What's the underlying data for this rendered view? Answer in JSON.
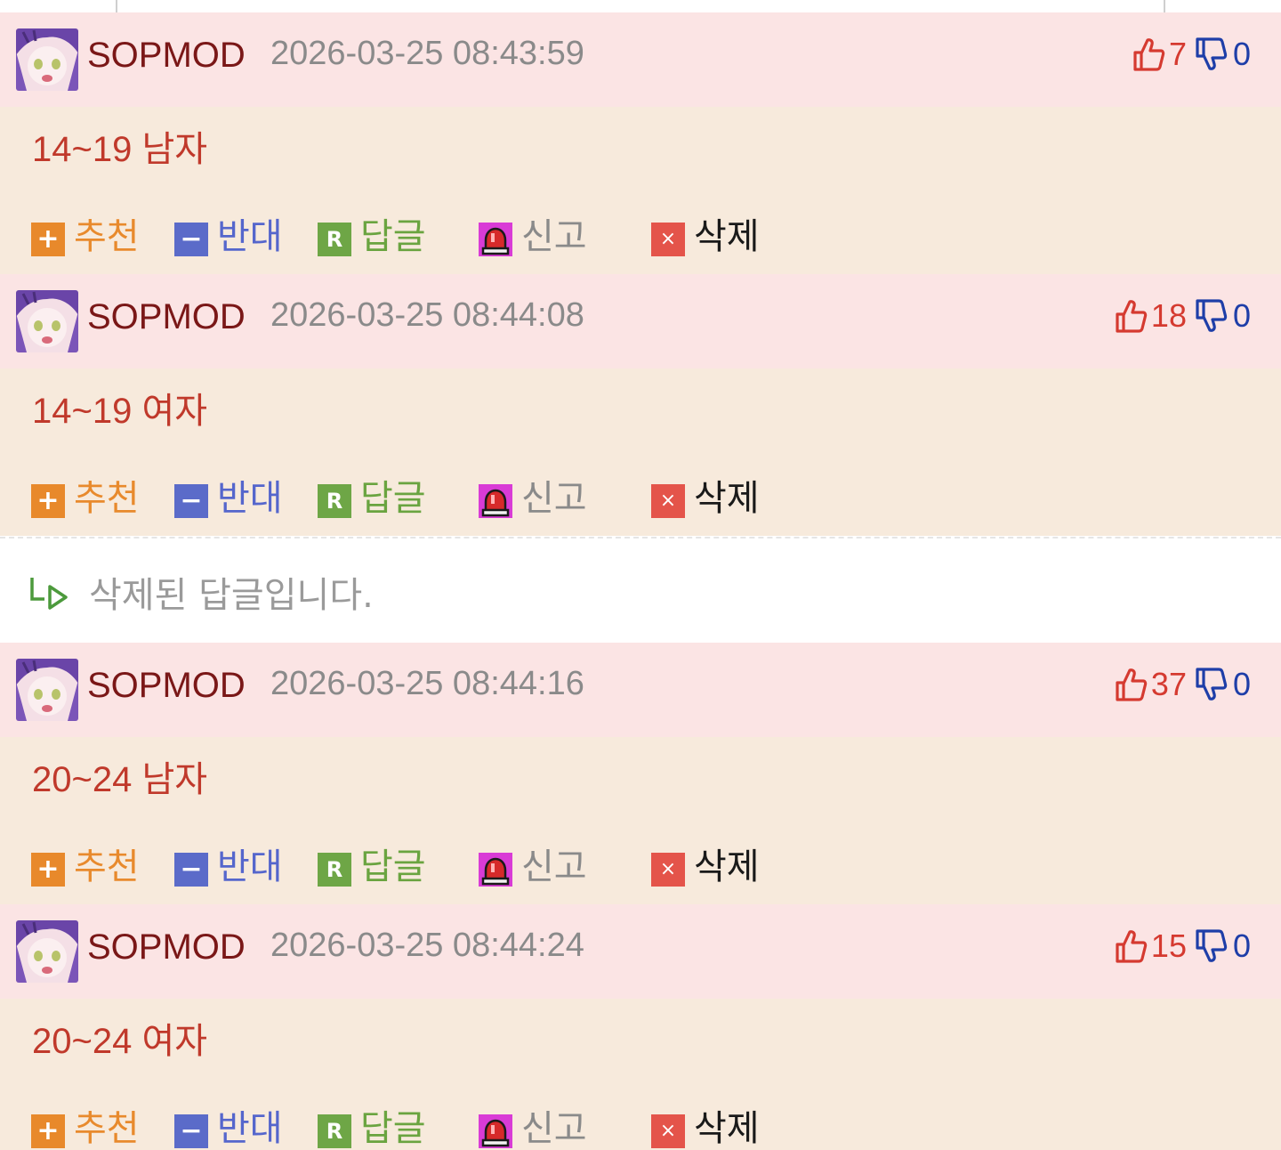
{
  "comments": [
    {
      "nick": "SOPMOD",
      "date": "2026-03-25 08:43:59",
      "text": "14~19 남자",
      "up": "7",
      "down": "0"
    },
    {
      "nick": "SOPMOD",
      "date": "2026-03-25 08:44:08",
      "text": "14~19 여자",
      "up": "18",
      "down": "0"
    },
    {
      "nick": "SOPMOD",
      "date": "2026-03-25 08:44:16",
      "text": "20~24 남자",
      "up": "37",
      "down": "0"
    },
    {
      "nick": "SOPMOD",
      "date": "2026-03-25 08:44:24",
      "text": "20~24 여자",
      "up": "15",
      "down": "0"
    }
  ],
  "actions": {
    "recommend": "추천",
    "oppose": "반대",
    "reply": "답글",
    "report": "신고",
    "delete": "삭제"
  },
  "deleted_reply": {
    "text": "삭제된 답글입니다."
  },
  "icons": {
    "vote_up": "thumbs-up-icon",
    "vote_down": "thumbs-down-icon",
    "recommend": "plus-icon",
    "oppose": "minus-icon",
    "reply": "reply-r-icon",
    "report": "siren-icon",
    "delete": "close-x-icon",
    "deleted_reply": "reply-arrow-icon"
  },
  "colors": {
    "header_bg": "#fbe4e4",
    "body_bg": "#f7eadc",
    "nick": "#7a1717",
    "comment_text": "#c0392b",
    "upvote": "#d53a30",
    "downvote": "#1e3ea8"
  }
}
